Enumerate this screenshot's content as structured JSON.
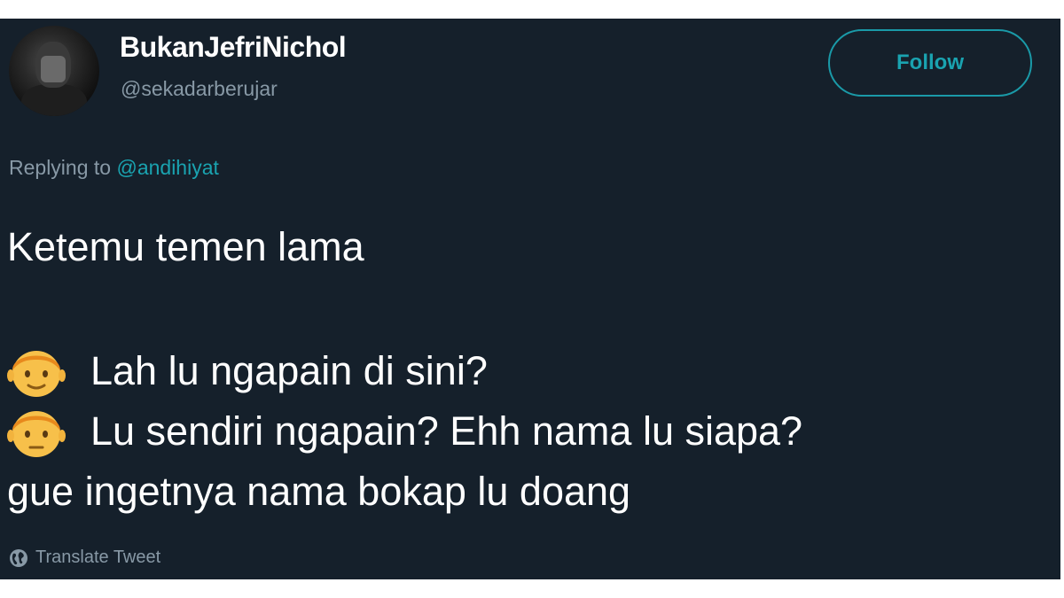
{
  "tweet": {
    "display_name": "BukanJefriNichol",
    "handle": "@sekadarberujar",
    "follow_label": "Follow",
    "replying_prefix": "Replying to",
    "replying_to": "@andihiyat",
    "lines": [
      "Ketemu temen lama",
      "Lah lu ngapain di sini?",
      "Lu sendiri ngapain? Ehh nama lu siapa?",
      "gue ingetnya nama bokap lu doang"
    ],
    "translate_label": "Translate Tweet"
  },
  "icons": {
    "line2_icon": "boy-face-emoji",
    "line3_icon": "boy-face-emoji",
    "translate_icon": "globe-icon"
  },
  "colors": {
    "background": "#15202b",
    "accent": "#1aa3b0",
    "secondary_text": "#8899a6",
    "emoji_skin": "#f7c04a",
    "emoji_hair": "#e8891c"
  }
}
